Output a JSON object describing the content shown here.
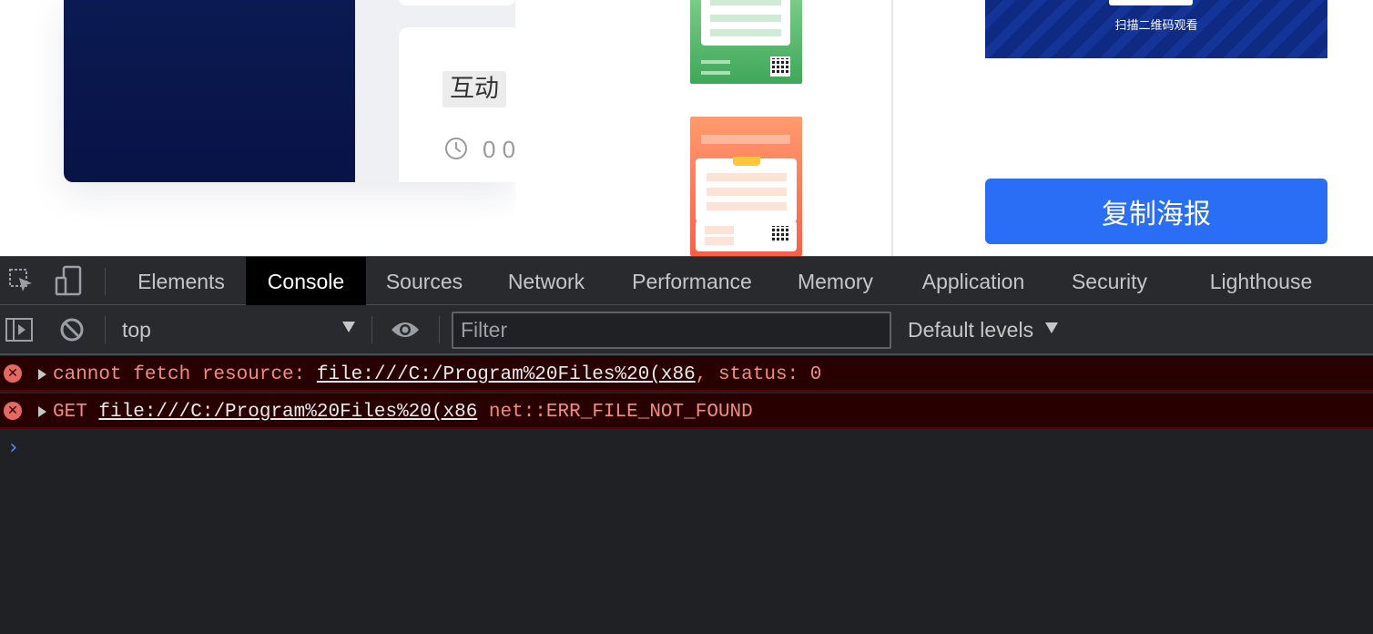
{
  "page": {
    "tag_label": "互动",
    "time_text": "0 0",
    "colors": {
      "thumb": "#0b1a52",
      "card_bg": "#ffffff"
    }
  },
  "modal": {
    "share_image_text": "扫描二维码观看",
    "copy_button_label": "复制海报",
    "colors": {
      "primary": "#2b6ef6",
      "poster_green": "#4fb466",
      "poster_red": "#fb6a4f"
    }
  },
  "devtools": {
    "tabs": [
      {
        "label": "Elements",
        "active": false
      },
      {
        "label": "Console",
        "active": true
      },
      {
        "label": "Sources",
        "active": false
      },
      {
        "label": "Network",
        "active": false
      },
      {
        "label": "Performance",
        "active": false
      },
      {
        "label": "Memory",
        "active": false
      },
      {
        "label": "Application",
        "active": false
      },
      {
        "label": "Security",
        "active": false
      },
      {
        "label": "Lighthouse",
        "active": false
      }
    ],
    "toolbar": {
      "context": "top",
      "filter_placeholder": "Filter",
      "filter_value": "",
      "levels": "Default levels"
    },
    "messages": [
      {
        "level": "error",
        "prefix": "cannot fetch resource: ",
        "link": "file:///C:/Program%20Files%20(x86",
        "suffix": ", status: 0"
      },
      {
        "level": "error",
        "prefix": "GET ",
        "link": "file:///C:/Program%20Files%20(x86",
        "suffix": " net::ERR_FILE_NOT_FOUND"
      }
    ],
    "prompt_symbol": "›",
    "colors": {
      "error_text": "#f28b82",
      "error_bg": "#290000",
      "prompt": "#4e8ef7"
    }
  }
}
